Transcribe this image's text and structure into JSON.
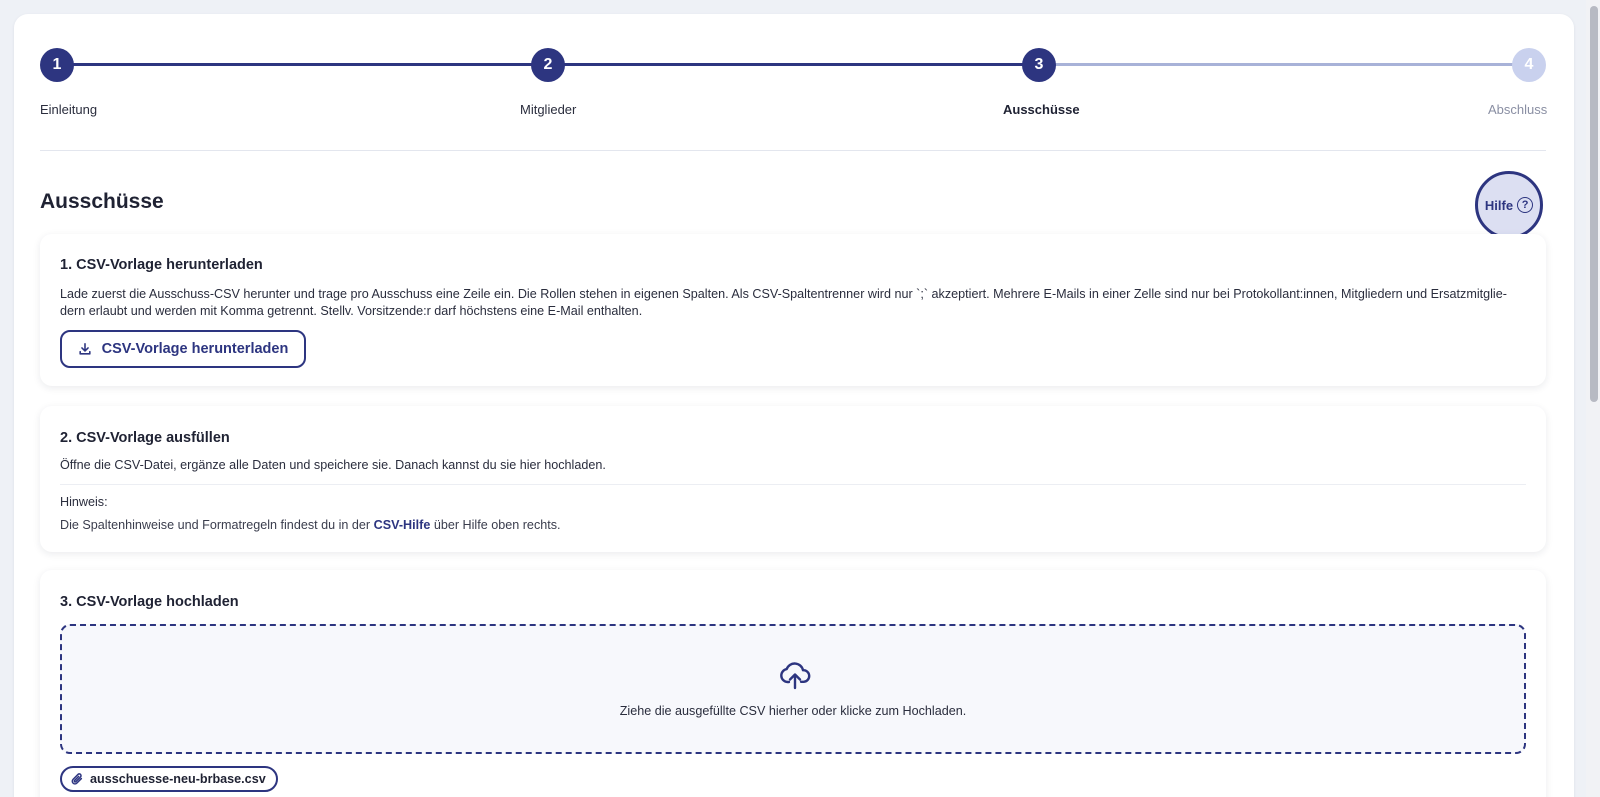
{
  "stepper": {
    "steps": [
      {
        "number": "1",
        "label": "Einleitung",
        "state": "done"
      },
      {
        "number": "2",
        "label": "Mitglieder",
        "state": "done"
      },
      {
        "number": "3",
        "label": "Ausschüsse",
        "state": "active"
      },
      {
        "number": "4",
        "label": "Abschluss",
        "state": "todo"
      }
    ]
  },
  "page": {
    "title": "Ausschüsse"
  },
  "help": {
    "label": "Hilfe",
    "icon": "question-circle-icon"
  },
  "card1": {
    "title": "1. CSV-Vorlage herunterladen",
    "text_line1": "Lade zuerst die Ausschuss-CSV herunter und trage pro Ausschuss eine Zeile ein. Die Rollen stehen in eigenen Spalten. Als CSV-Spaltentrenner wird nur `;` akzeptiert. Mehrere E-Mails in einer Zelle sind nur bei Protokollant:innen, Mitgliedern und Ersatzmitglie-",
    "text_line2": "dern erlaubt und werden mit Komma getrennt. Stellv. Vorsitzende:r darf höchstens eine E-Mail enthalten.",
    "button_label": "CSV-Vorlage herunterladen",
    "button_icon": "download-icon"
  },
  "card2": {
    "title": "2. CSV-Vorlage ausfüllen",
    "text": "Öffne die CSV-Datei, ergänze alle Daten und speichere sie. Danach kannst du sie hier hochladen.",
    "note_title": "Hinweis:",
    "note_before": "Die Spaltenhinweise und Formatregeln findest du in der ",
    "note_link": "CSV-Hilfe",
    "note_after": " über Hilfe oben rechts."
  },
  "card3": {
    "title": "3. CSV-Vorlage hochladen",
    "drop_text": "Ziehe die ausgefüllte CSV hierher oder klicke zum Hochladen.",
    "drop_icon": "cloud-upload-icon",
    "file_name": "ausschuesse-neu-brbase.csv",
    "file_icon": "paperclip-icon"
  },
  "colors": {
    "primary": "#2d3580",
    "todo": "#c9d1ee",
    "background": "#eef1f6"
  }
}
